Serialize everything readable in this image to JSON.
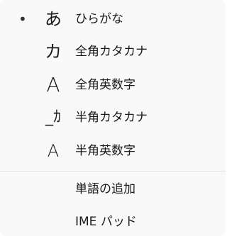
{
  "ime_menu": {
    "modes": [
      {
        "bullet": "•",
        "glyph": "あ",
        "label": "ひらがな"
      },
      {
        "bullet": "",
        "glyph": "カ",
        "label": "全角カタカナ"
      },
      {
        "bullet": "",
        "glyph": "A",
        "label": "全角英数字"
      },
      {
        "bullet": "",
        "glyph": "_ｶ",
        "label": "半角カタカナ"
      },
      {
        "bullet": "",
        "glyph": "A",
        "label": "半角英数字"
      }
    ],
    "actions": [
      {
        "label": "単語の追加"
      },
      {
        "label": "IME パッド"
      }
    ]
  }
}
